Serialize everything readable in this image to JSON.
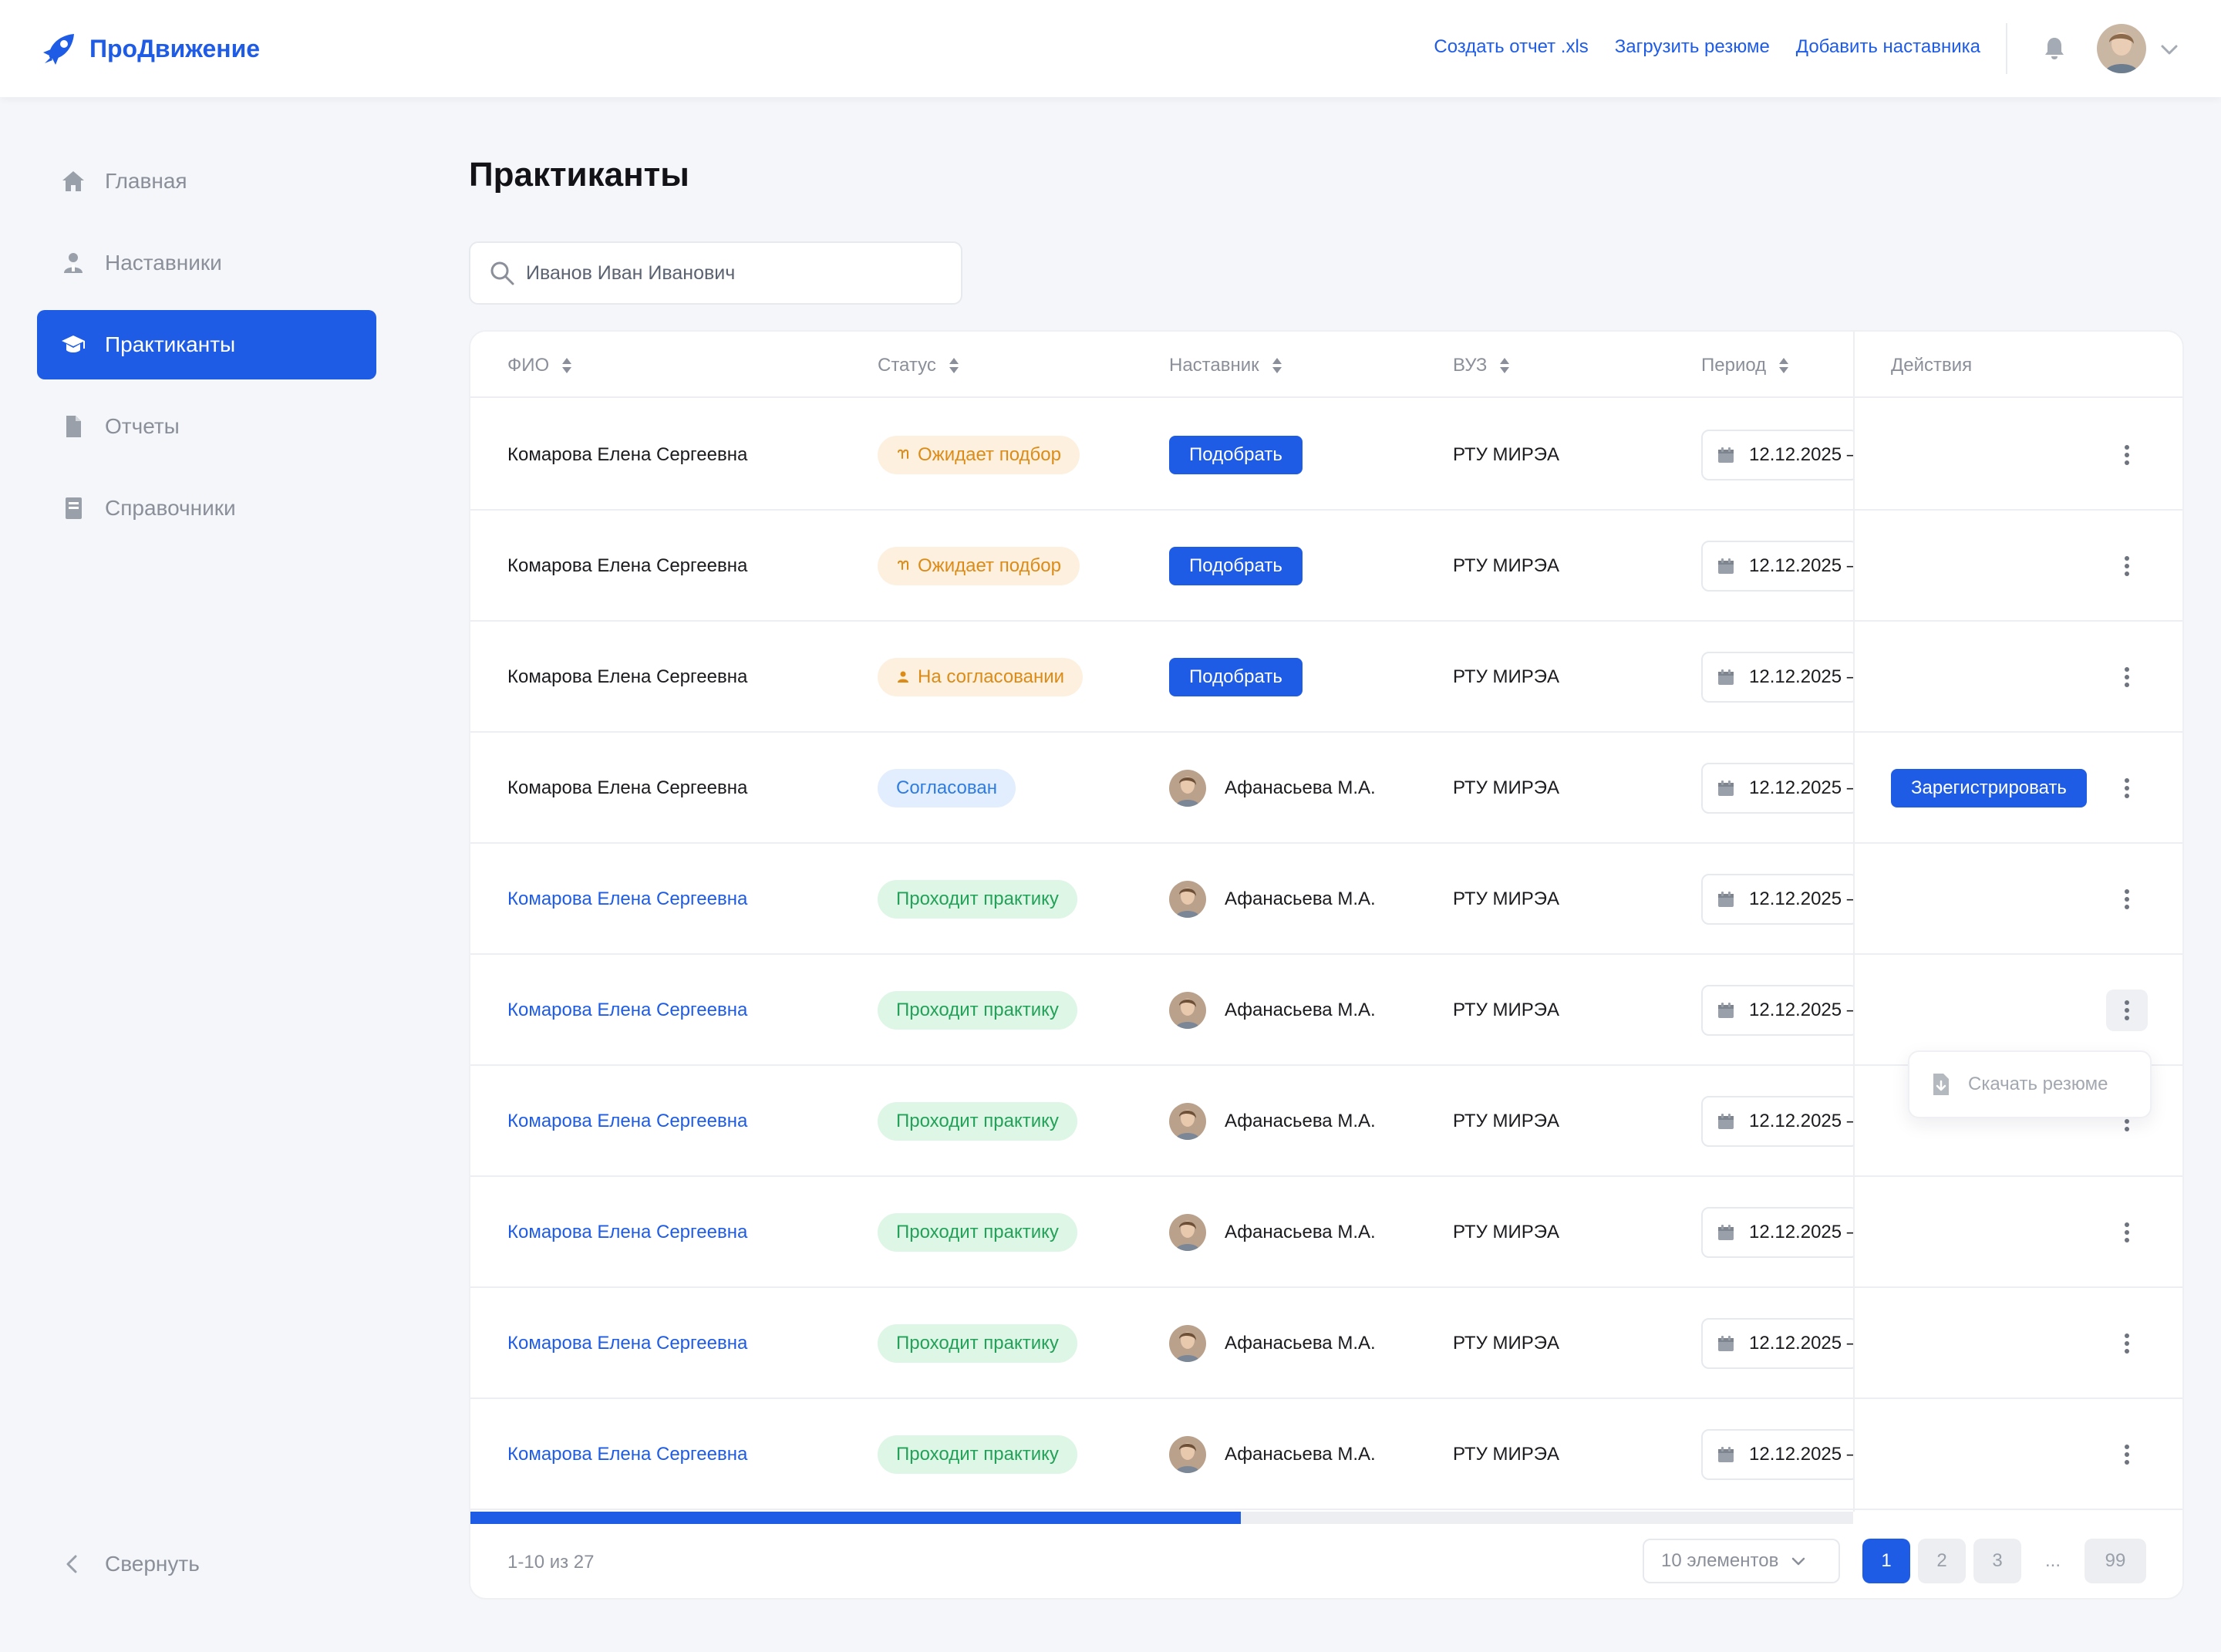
{
  "app": {
    "brand": "ПроДвижение",
    "accent": "#1f5ce6"
  },
  "header": {
    "links": [
      {
        "label": "Создать отчет .xls"
      },
      {
        "label": "Загрузить резюме"
      },
      {
        "label": "Добавить наставника"
      }
    ],
    "icons": [
      "bell-icon",
      "user-avatar",
      "chevron-down-icon"
    ]
  },
  "sidebar": {
    "items": [
      {
        "label": "Главная",
        "icon": "home-icon",
        "active": false
      },
      {
        "label": "Наставники",
        "icon": "mentor-icon",
        "active": false
      },
      {
        "label": "Практиканты",
        "icon": "graduation-cap-icon",
        "active": true
      },
      {
        "label": "Отчеты",
        "icon": "document-icon",
        "active": false
      },
      {
        "label": "Справочники",
        "icon": "book-icon",
        "active": false
      }
    ],
    "collapse_label": "Свернуть"
  },
  "main": {
    "title": "Практиканты",
    "search": {
      "value": "Иванов Иван Иванович",
      "placeholder": ""
    },
    "table": {
      "columns": {
        "fio": "ФИО",
        "status": "Статус",
        "mentor": "Наставник",
        "vuz": "ВУЗ",
        "period": "Период",
        "actions": "Действия"
      },
      "rows": [
        {
          "fio": "Комарова Елена Сергеевна",
          "status": "Ожидает подбор",
          "mentor_button": "Подобрать",
          "vuz": "РТУ МИРЭА",
          "period": "12.12.2025 –"
        },
        {
          "fio": "Комарова Елена Сергеевна",
          "status": "Ожидает подбор",
          "mentor_button": "Подобрать",
          "vuz": "РТУ МИРЭА",
          "period": "12.12.2025 –"
        },
        {
          "fio": "Комарова Елена Сергеевна",
          "status": "На согласовании",
          "mentor_button": "Подобрать",
          "vuz": "РТУ МИРЭА",
          "period": "12.12.2025 –"
        },
        {
          "fio": "Комарова Елена Сергеевна",
          "status": "Согласован",
          "mentor": "Афанасьева М.А.",
          "vuz": "РТУ МИРЭА",
          "period": "12.12.2025 –",
          "action_button": "Зарегистрировать"
        },
        {
          "fio": "Комарова Елена Сергеевна",
          "status": "Проходит практику",
          "mentor": "Афанасьева М.А.",
          "vuz": "РТУ МИРЭА",
          "period": "12.12.2025 –"
        },
        {
          "fio": "Комарова Елена Сергеевна",
          "status": "Проходит практику",
          "mentor": "Афанасьева М.А.",
          "vuz": "РТУ МИРЭА",
          "period": "12.12.2025 –"
        },
        {
          "fio": "Комарова Елена Сергеевна",
          "status": "Проходит практику",
          "mentor": "Афанасьева М.А.",
          "vuz": "РТУ МИРЭА",
          "period": "12.12.2025 –"
        },
        {
          "fio": "Комарова Елена Сергеевна",
          "status": "Проходит практику",
          "mentor": "Афанасьева М.А.",
          "vuz": "РТУ МИРЭА",
          "period": "12.12.2025 –"
        },
        {
          "fio": "Комарова Елена Сергеевна",
          "status": "Проходит практику",
          "mentor": "Афанасьева М.А.",
          "vuz": "РТУ МИРЭА",
          "period": "12.12.2025 –"
        },
        {
          "fio": "Комарова Елена Сергеевна",
          "status": "Проходит практику",
          "mentor": "Афанасьева М.А.",
          "vuz": "РТУ МИРЭА",
          "period": "12.12.2025 –"
        }
      ],
      "row_menu": {
        "open_row": 6,
        "item": "Скачать резюме",
        "icon": "download-file-icon"
      },
      "horizontal_scroll_fraction": 0.557
    },
    "footer": {
      "range": "1-10 из 27",
      "per_page": "10 элементов",
      "pages": [
        "1",
        "2",
        "3",
        "...",
        "99"
      ],
      "current_page": "1"
    }
  },
  "colors": {
    "wait_bg": "#fdf0df",
    "wait_text": "#dc8b16",
    "agree_bg": "#e2eefd",
    "agree_text": "#2f7ce0",
    "prac_bg": "#ddf6e6",
    "prac_text": "#24a159"
  }
}
